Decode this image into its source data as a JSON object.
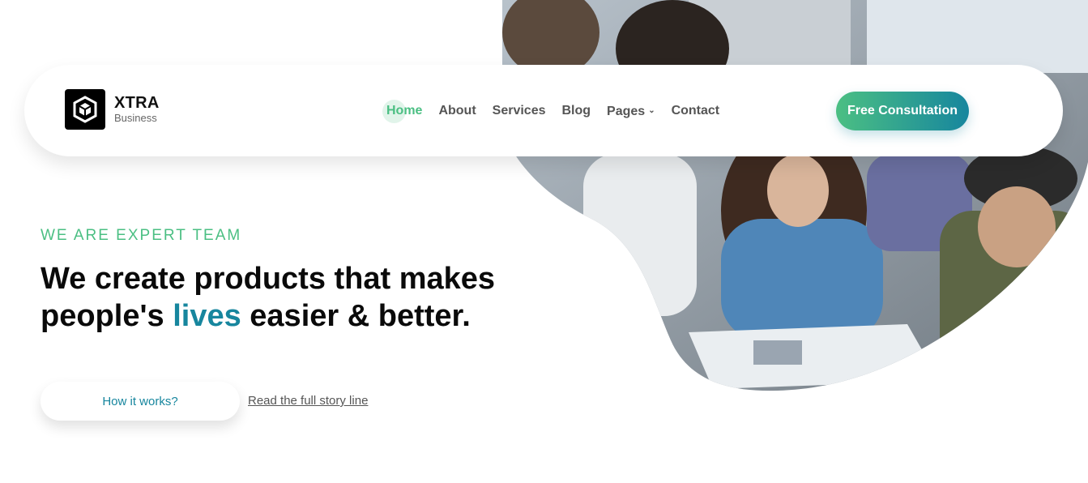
{
  "brand": {
    "name": "XTRA",
    "tagline": "Business",
    "logo_icon": "cube-icon"
  },
  "nav": {
    "items": [
      {
        "label": "Home",
        "active": true
      },
      {
        "label": "About",
        "active": false
      },
      {
        "label": "Services",
        "active": false
      },
      {
        "label": "Blog",
        "active": false
      },
      {
        "label": "Pages",
        "active": false,
        "has_dropdown": true
      },
      {
        "label": "Contact",
        "active": false
      }
    ]
  },
  "cta": {
    "label": "Free Consultation"
  },
  "hero": {
    "eyebrow": "WE ARE EXPERT TEAM",
    "headline_part1": "We create products that makes",
    "headline_part2": "people's ",
    "headline_highlight": "lives",
    "headline_part3": " easier & better.",
    "primary_button": "How it works?",
    "secondary_link": "Read the full story line",
    "image": "team-working-photo"
  },
  "colors": {
    "accent_green": "#4bbf83",
    "accent_teal": "#17869e",
    "text_dark": "#0a0a0a"
  }
}
